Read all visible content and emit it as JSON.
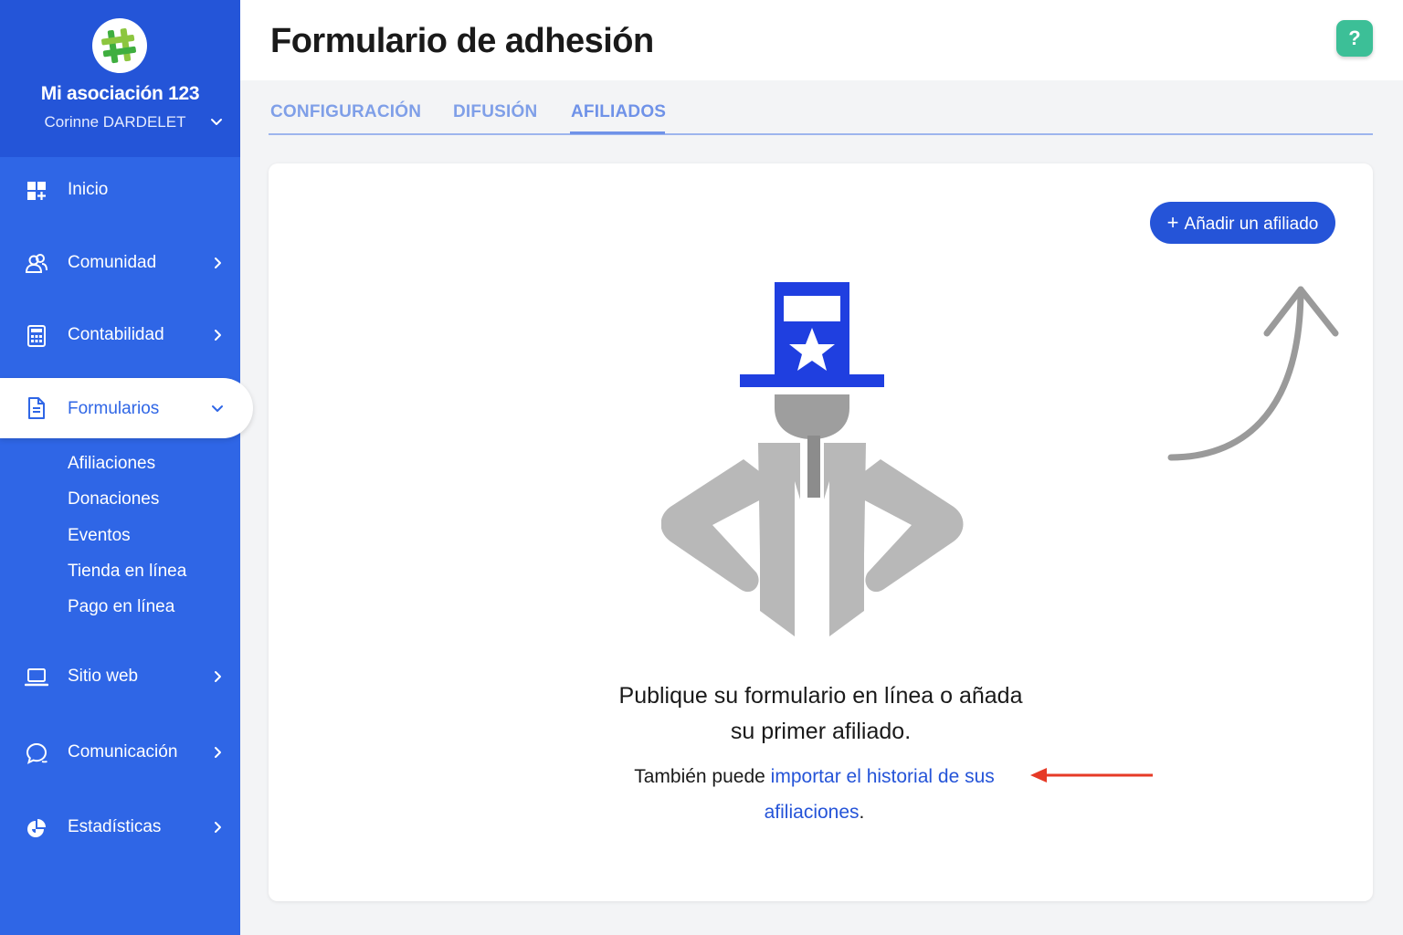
{
  "sidebar": {
    "org_name": "Mi asociación 123",
    "user_name": "Corinne DARDELET",
    "items": [
      {
        "label": "Inicio",
        "icon": "dashboard-icon"
      },
      {
        "label": "Comunidad",
        "icon": "users-icon"
      },
      {
        "label": "Contabilidad",
        "icon": "calculator-icon"
      },
      {
        "label": "Formularios",
        "icon": "document-icon"
      },
      {
        "label": "Sitio web",
        "icon": "laptop-icon"
      },
      {
        "label": "Comunicación",
        "icon": "chat-icon"
      },
      {
        "label": "Estadísticas",
        "icon": "pie-chart-icon"
      }
    ],
    "sub_items": [
      "Afiliaciones",
      "Donaciones",
      "Eventos",
      "Tienda en línea",
      "Pago en línea"
    ]
  },
  "header": {
    "title": "Formulario de adhesión",
    "help_label": "?"
  },
  "tabs": [
    "CONFIGURACIÓN",
    "DIFUSIÓN",
    "AFILIADOS"
  ],
  "active_tab": "AFILIADOS",
  "card": {
    "add_button_label": "Añadir un afiliado",
    "add_button_plus": "+",
    "message_line1": "Publique su formulario en línea o añada",
    "message_line2": "su primer afiliado.",
    "import_prefix": "También puede ",
    "import_link": "importar el historial de sus afiliaciones",
    "import_suffix": "."
  },
  "colors": {
    "sidebar": "#2f66e6",
    "primary": "#2554d8",
    "help": "#3cbf97",
    "annotation_arrow": "#e63a26"
  }
}
